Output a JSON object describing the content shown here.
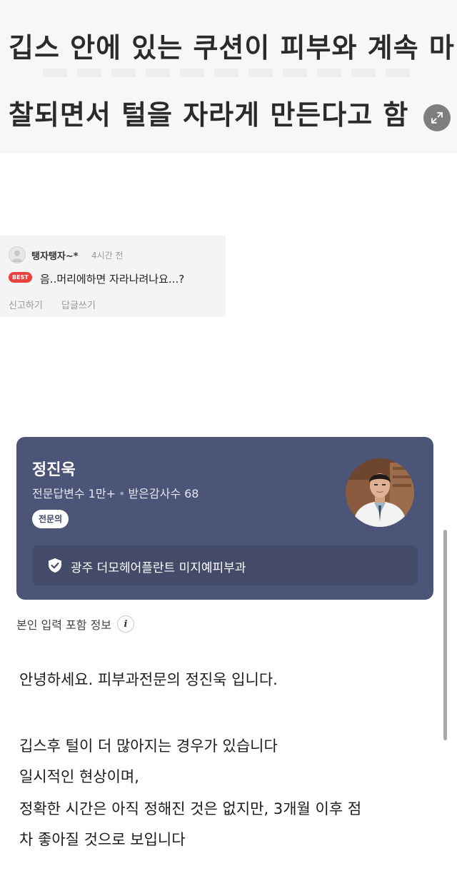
{
  "caption": {
    "line1": "깁스 안에 있는 쿠션이 피부와 계속 마",
    "line2": "찰되면서 털을 자라게 만든다고 함"
  },
  "comment": {
    "author": "탱자탱자~*",
    "time": "4시간 전",
    "badge": "BEST",
    "text": "음..머리에하면 자라나려나요...?",
    "actions": {
      "report": "신고하기",
      "reply": "답글쓰기"
    }
  },
  "doctor": {
    "name": "정진욱",
    "answers_label": "전문답변수 1만+",
    "separator": "•",
    "thanks_label": "받은감사수 68",
    "badge": "전문의",
    "clinic": "광주 더모헤어플란트 미지예피부과"
  },
  "info": {
    "label": "본인 입력 포함 정보",
    "icon_glyph": "i"
  },
  "answer": {
    "lines": [
      "안녕하세요. 피부과전문의 정진욱 입니다.",
      "깁스후 털이 더 많아지는 경우가 있습니다",
      "일시적인 현상이며,",
      "정확한 시간은 아직 정해진 것은 없지만, 3개월 이후 점",
      "차 좋아질 것으로 보입니다"
    ]
  },
  "colors": {
    "card_background": "#4c5577",
    "clinic_bar": "#434b69",
    "best_badge": "#e8413e",
    "caption_background": "#f7f7f8"
  },
  "icons": {
    "expand": "expand-arrows-icon",
    "shield": "shield-check-icon",
    "info": "info-icon",
    "avatar": "default-avatar-icon"
  }
}
